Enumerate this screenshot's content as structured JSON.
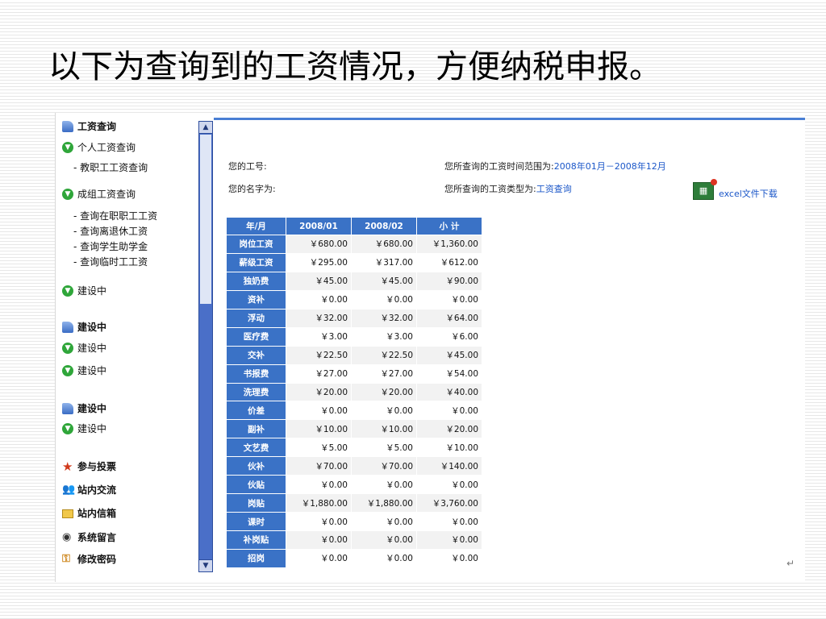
{
  "slide_title": "以下为查询到的工资情况，方便纳税申报。",
  "sidebar": {
    "items": [
      {
        "type": "section",
        "icon": "folder-icon",
        "label": "工资查询"
      },
      {
        "type": "group",
        "icon": "arrow-circle-icon",
        "label": "个人工资查询"
      },
      {
        "type": "sub",
        "label": "- 教职工工资查询"
      },
      {
        "type": "group",
        "icon": "arrow-circle-icon",
        "label": "成组工资查询"
      },
      {
        "type": "sub",
        "label": "- 查询在职职工工资"
      },
      {
        "type": "sub",
        "label": "- 查询离退休工资"
      },
      {
        "type": "sub",
        "label": "- 查询学生助学金"
      },
      {
        "type": "sub",
        "label": "- 查询临时工工资"
      },
      {
        "type": "group",
        "icon": "arrow-circle-icon",
        "label": "建设中"
      },
      {
        "type": "section",
        "icon": "folder-icon",
        "label": "建设中"
      },
      {
        "type": "group",
        "icon": "arrow-circle-icon",
        "label": "建设中"
      },
      {
        "type": "group",
        "icon": "arrow-circle-icon",
        "label": "建设中"
      },
      {
        "type": "section",
        "icon": "folder-icon",
        "label": "建设中"
      },
      {
        "type": "group",
        "icon": "arrow-circle-icon",
        "label": "建设中"
      },
      {
        "type": "section",
        "icon": "star-icon",
        "label": "参与投票"
      },
      {
        "type": "section",
        "icon": "users-icon",
        "label": "站内交流"
      },
      {
        "type": "section",
        "icon": "mail-icon",
        "label": "站内信箱"
      },
      {
        "type": "section",
        "icon": "person-icon",
        "label": "系统留言"
      },
      {
        "type": "section",
        "icon": "key-icon",
        "label": "修改密码"
      }
    ],
    "scroll_up": "▲",
    "scroll_down": "▼"
  },
  "info": {
    "employee_id_label": "您的工号:",
    "name_label": "您的名字为:",
    "range_label": "您所查询的工资时间范围为:",
    "range_value": "2008年01月－2008年12月",
    "type_label": "您所查询的工资类型为:",
    "type_value": "工资查询"
  },
  "excel": {
    "icon": "excel-icon",
    "icon_glyph": "▦",
    "label": "excel文件下载"
  },
  "table": {
    "headers": [
      "年/月",
      "2008/01",
      "2008/02",
      "小 计"
    ],
    "rows": [
      [
        "岗位工资",
        "￥680.00",
        "￥680.00",
        "￥1,360.00"
      ],
      [
        "薪级工资",
        "￥295.00",
        "￥317.00",
        "￥612.00"
      ],
      [
        "独奶费",
        "￥45.00",
        "￥45.00",
        "￥90.00"
      ],
      [
        "资补",
        "￥0.00",
        "￥0.00",
        "￥0.00"
      ],
      [
        "浮动",
        "￥32.00",
        "￥32.00",
        "￥64.00"
      ],
      [
        "医疗费",
        "￥3.00",
        "￥3.00",
        "￥6.00"
      ],
      [
        "交补",
        "￥22.50",
        "￥22.50",
        "￥45.00"
      ],
      [
        "书报费",
        "￥27.00",
        "￥27.00",
        "￥54.00"
      ],
      [
        "洗理费",
        "￥20.00",
        "￥20.00",
        "￥40.00"
      ],
      [
        "价差",
        "￥0.00",
        "￥0.00",
        "￥0.00"
      ],
      [
        "副补",
        "￥10.00",
        "￥10.00",
        "￥20.00"
      ],
      [
        "文艺费",
        "￥5.00",
        "￥5.00",
        "￥10.00"
      ],
      [
        "伙补",
        "￥70.00",
        "￥70.00",
        "￥140.00"
      ],
      [
        "伙贴",
        "￥0.00",
        "￥0.00",
        "￥0.00"
      ],
      [
        "岗贴",
        "￥1,880.00",
        "￥1,880.00",
        "￥3,760.00"
      ],
      [
        "课时",
        "￥0.00",
        "￥0.00",
        "￥0.00"
      ],
      [
        "补岗贴",
        "￥0.00",
        "￥0.00",
        "￥0.00"
      ],
      [
        "招岗",
        "￥0.00",
        "￥0.00",
        "￥0.00"
      ]
    ]
  },
  "return_mark": "↵"
}
